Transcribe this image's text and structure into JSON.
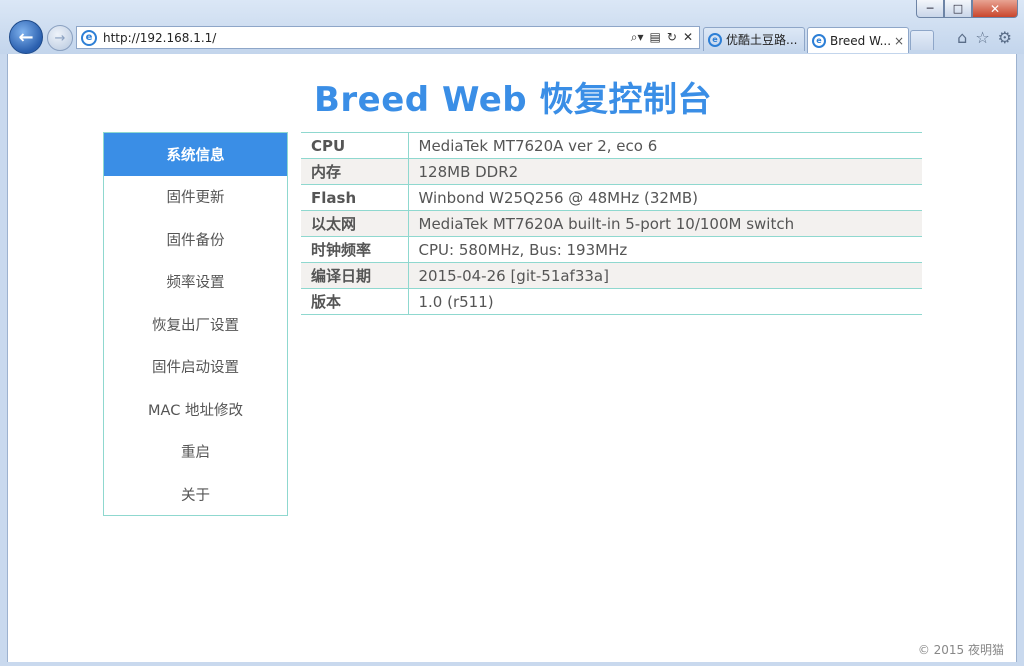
{
  "browser": {
    "address": "http://192.168.1.1/",
    "tabs": [
      {
        "label": "优酷土豆路..."
      },
      {
        "label": "Breed W...",
        "close": "×"
      }
    ],
    "window_buttons": {
      "minimize": "─",
      "maximize": "□",
      "close": "✕"
    }
  },
  "page": {
    "title": "Breed Web 恢复控制台",
    "sidebar": [
      {
        "label": "系统信息",
        "active": true
      },
      {
        "label": "固件更新"
      },
      {
        "label": "固件备份"
      },
      {
        "label": "频率设置"
      },
      {
        "label": "恢复出厂设置"
      },
      {
        "label": "固件启动设置"
      },
      {
        "label": "MAC 地址修改"
      },
      {
        "label": "重启"
      },
      {
        "label": "关于"
      }
    ],
    "info": [
      {
        "key": "CPU",
        "value": "MediaTek MT7620A ver 2, eco 6"
      },
      {
        "key": "内存",
        "value": "128MB DDR2"
      },
      {
        "key": "Flash",
        "value": "Winbond W25Q256 @ 48MHz (32MB)"
      },
      {
        "key": "以太网",
        "value": "MediaTek MT7620A built-in 5-port 10/100M switch"
      },
      {
        "key": "时钟频率",
        "value": "CPU: 580MHz, Bus: 193MHz"
      },
      {
        "key": "编译日期",
        "value": "2015-04-26 [git-51af33a]"
      },
      {
        "key": "版本",
        "value": "1.0 (r511)"
      }
    ]
  },
  "watermark": "© 2015 夜明猫",
  "colors": {
    "accent": "#3a8ee6",
    "border": "#8fd8cf",
    "row_alt": "#f3f1ef"
  }
}
